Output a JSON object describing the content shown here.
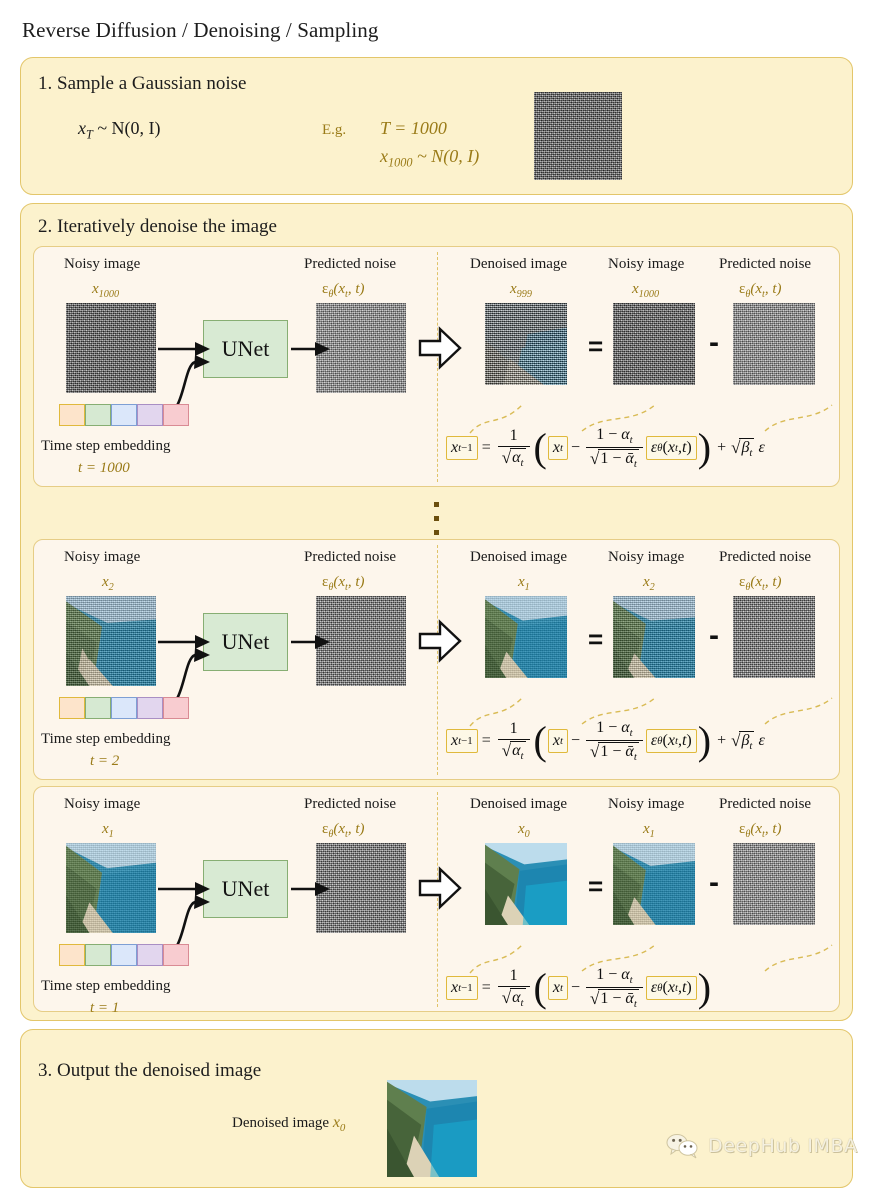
{
  "page": {
    "title": "Reverse Diffusion / Denoising / Sampling"
  },
  "colors": {
    "panel_bg": "#fcf2cd",
    "panel_border": "#e3c66a",
    "subpanel_bg": "#fdf6ec",
    "subpanel_border": "#e6cd86",
    "accent_math": "#9a7b18",
    "unet_fill": "#d8ead3",
    "unet_border": "#87ae73",
    "box_highlight": "#e0b93c",
    "divider": "#e0c36a"
  },
  "step1": {
    "heading": "1. Sample a Gaussian noise",
    "formula": "x_T ~ N(0, I)",
    "formula_parts": {
      "base": "x",
      "sub": "T",
      "rest": "~ N(0, I)"
    },
    "eg_label": "E.g.",
    "eg_line1": "T = 1000",
    "eg_line2_base": "x",
    "eg_line2_sub": "1000",
    "eg_line2_rest": "~ N(0, I)",
    "sample_image_alt": "gaussian-noise-tile"
  },
  "step2": {
    "heading": "2. Iteratively denoise the image",
    "ellipsis": "⋮",
    "blocks": [
      {
        "left": {
          "noisy_label": "Noisy image",
          "noisy_sym_base": "x",
          "noisy_sym_sub": "1000",
          "unet_label": "UNet",
          "pred_label": "Predicted noise",
          "pred_sym": "ε_θ(x_t, t)",
          "embedding_label": "Time step embedding",
          "t_value": "t = 1000"
        },
        "right": {
          "denoised_label": "Denoised image",
          "denoised_sym_base": "x",
          "denoised_sym_sub": "999",
          "noisy_label": "Noisy image",
          "noisy_sym_base": "x",
          "noisy_sym_sub": "1000",
          "pred_label": "Predicted noise",
          "pred_sym": "ε_θ(x_t, t)",
          "equals": "=",
          "minus": "-"
        },
        "formula": {
          "lhs": "x_{t-1}",
          "equals": "=",
          "coef_num": "1",
          "coef_den": "√α_t",
          "open": "(",
          "term1": "x_t",
          "sign": "−",
          "frac_num": "1 − α_t",
          "frac_den": "√(1 − ᾱ_t)",
          "eps_term": "ε_θ(x_t, t)",
          "close": ")",
          "plus": "+",
          "noise_term": "√β_t ε",
          "has_noise_term": true
        }
      },
      {
        "left": {
          "noisy_label": "Noisy image",
          "noisy_sym_base": "x",
          "noisy_sym_sub": "2",
          "unet_label": "UNet",
          "pred_label": "Predicted noise",
          "pred_sym": "ε_θ(x_t, t)",
          "embedding_label": "Time step embedding",
          "t_value": "t = 2"
        },
        "right": {
          "denoised_label": "Denoised image",
          "denoised_sym_base": "x",
          "denoised_sym_sub": "1",
          "noisy_label": "Noisy image",
          "noisy_sym_base": "x",
          "noisy_sym_sub": "2",
          "pred_label": "Predicted noise",
          "pred_sym": "ε_θ(x_t, t)",
          "equals": "=",
          "minus": "-"
        },
        "formula": {
          "lhs": "x_{t-1}",
          "equals": "=",
          "coef_num": "1",
          "coef_den": "√α_t",
          "open": "(",
          "term1": "x_t",
          "sign": "−",
          "frac_num": "1 − α_t",
          "frac_den": "√(1 − ᾱ_t)",
          "eps_term": "ε_θ(x_t, t)",
          "close": ")",
          "plus": "+",
          "noise_term": "√β_t ε",
          "has_noise_term": true
        }
      },
      {
        "left": {
          "noisy_label": "Noisy image",
          "noisy_sym_base": "x",
          "noisy_sym_sub": "1",
          "unet_label": "UNet",
          "pred_label": "Predicted noise",
          "pred_sym": "ε_θ(x_t, t)",
          "embedding_label": "Time step embedding",
          "t_value": "t = 1"
        },
        "right": {
          "denoised_label": "Denoised image",
          "denoised_sym_base": "x",
          "denoised_sym_sub": "0",
          "noisy_label": "Noisy image",
          "noisy_sym_base": "x",
          "noisy_sym_sub": "1",
          "pred_label": "Predicted noise",
          "pred_sym": "ε_θ(x_t, t)",
          "equals": "=",
          "minus": "-"
        },
        "formula": {
          "lhs": "x_{t-1}",
          "equals": "=",
          "coef_num": "1",
          "coef_den": "√α_t",
          "open": "(",
          "term1": "x_t",
          "sign": "−",
          "frac_num": "1 − α_t",
          "frac_den": "√(1 − ᾱ_t)",
          "eps_term": "ε_θ(x_t, t)",
          "close": ")",
          "plus": "",
          "noise_term": "",
          "has_noise_term": false
        }
      }
    ],
    "embedding_cells": [
      {
        "fill": "#fde4cb",
        "border": "#e0b93c"
      },
      {
        "fill": "#d6e9d2",
        "border": "#87ae73"
      },
      {
        "fill": "#dbe7fa",
        "border": "#7e9fd4"
      },
      {
        "fill": "#e2d6ee",
        "border": "#a98fc4"
      },
      {
        "fill": "#f8ccd0",
        "border": "#d98b94"
      }
    ]
  },
  "step3": {
    "heading": "3. Output the denoised image",
    "caption": "Denoised image",
    "caption_sym_base": "x",
    "caption_sym_sub": "0"
  },
  "watermark": {
    "text": "DeepHub IMBA",
    "icon": "wechat-icon"
  }
}
